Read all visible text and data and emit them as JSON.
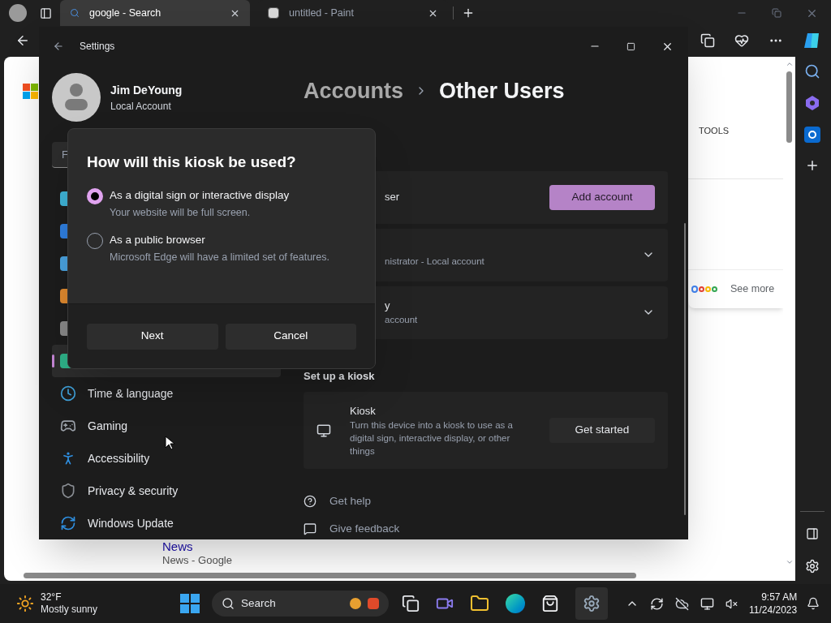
{
  "browser": {
    "tabs": [
      {
        "title": "google - Search",
        "selected": true
      },
      {
        "title": "untitled - Paint",
        "selected": false
      }
    ],
    "page": {
      "tools_label": "TOOLS",
      "see_more": "See more",
      "news_title": "News",
      "news_source": "News - Google"
    }
  },
  "settings": {
    "title": "Settings",
    "user": {
      "name": "Jim DeYoung",
      "account_type": "Local Account"
    },
    "search_placeholder": "F",
    "nav": [
      {
        "selected": false,
        "color": "#3fb4d8"
      },
      {
        "selected": false,
        "color": "#2f7fe0"
      },
      {
        "selected": false,
        "color": "#4aa3e0"
      },
      {
        "selected": false,
        "color": "#e08a2f"
      },
      {
        "selected": false,
        "color": "#8a8a8a"
      },
      {
        "selected": true,
        "color": "#2fb38a"
      },
      {
        "label": "Time & language",
        "selected": false,
        "color": "#3fa0d8"
      },
      {
        "label": "Gaming",
        "selected": false,
        "color": "#9aa0a8"
      },
      {
        "label": "Accessibility",
        "selected": false,
        "color": "#2f8fe0"
      },
      {
        "label": "Privacy & security",
        "selected": false,
        "color": "#8a8e94"
      },
      {
        "label": "Windows Update",
        "selected": false,
        "color": "#2f8fe0"
      }
    ],
    "breadcrumb": {
      "parent": "Accounts",
      "current": "Other Users"
    },
    "add_user": {
      "label": "ser",
      "button": "Add account"
    },
    "accounts": [
      {
        "line_2": "nistrator - Local account"
      },
      {
        "line_1": "y",
        "line_2": "account"
      }
    ],
    "kiosk_section": "Set up a kiosk",
    "kiosk": {
      "title": "Kiosk",
      "description": "Turn this device into a kiosk to use as a digital sign, interactive display, or other things",
      "button": "Get started"
    },
    "links": [
      "Get help",
      "Give feedback"
    ]
  },
  "dialog": {
    "title": "How will this kiosk be used?",
    "options": [
      {
        "label": "As a digital sign or interactive display",
        "description": "Your website will be full screen.",
        "selected": true
      },
      {
        "label": "As a public browser",
        "description": "Microsoft Edge will have a limited set of features.",
        "selected": false
      }
    ],
    "buttons": [
      "Next",
      "Cancel"
    ]
  },
  "taskbar": {
    "weather": {
      "temp": "32°F",
      "condition": "Mostly sunny"
    },
    "search": "Search",
    "time": "9:57 AM",
    "date": "11/24/2023"
  }
}
